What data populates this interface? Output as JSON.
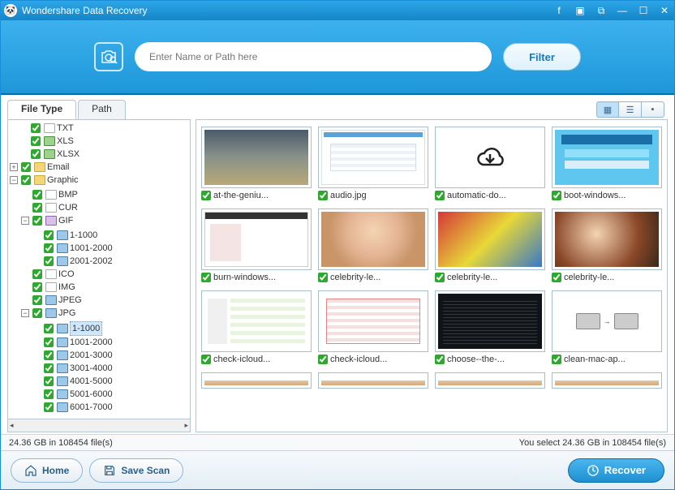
{
  "titlebar": {
    "title": "Wondershare Data Recovery"
  },
  "search": {
    "placeholder": "Enter Name or Path here",
    "filter_label": "Filter"
  },
  "tabs": {
    "filetype": "File Type",
    "path": "Path"
  },
  "tree": {
    "txt": "TXT",
    "xls": "XLS",
    "xlsx": "XLSX",
    "email": "Email",
    "graphic": "Graphic",
    "bmp": "BMP",
    "cur": "CUR",
    "gif": "GIF",
    "g1": "1-1000",
    "g2": "1001-2000",
    "g3": "2001-2002",
    "ico": "ICO",
    "img": "IMG",
    "jpeg": "JPEG",
    "jpg": "JPG",
    "j1": "1-1000",
    "j2": "1001-2000",
    "j3": "2001-3000",
    "j4": "3001-4000",
    "j5": "4001-5000",
    "j6": "5001-6000",
    "j7": "6001-7000"
  },
  "thumbs": {
    "r1c1": "at-the-geniu...",
    "r1c2": "audio.jpg",
    "r1c3": "automatic-do...",
    "r1c4": "boot-windows...",
    "r2c1": "burn-windows...",
    "r2c2": "celebrity-le...",
    "r2c3": "celebrity-le...",
    "r2c4": "celebrity-le...",
    "r3c1": "check-icloud...",
    "r3c2": "check-icloud...",
    "r3c3": "choose--the-...",
    "r3c4": "clean-mac-ap..."
  },
  "status": {
    "left": "24.36 GB in 108454 file(s)",
    "right": "You select 24.36 GB in 108454 file(s)"
  },
  "footer": {
    "home": "Home",
    "savescan": "Save Scan",
    "recover": "Recover"
  }
}
